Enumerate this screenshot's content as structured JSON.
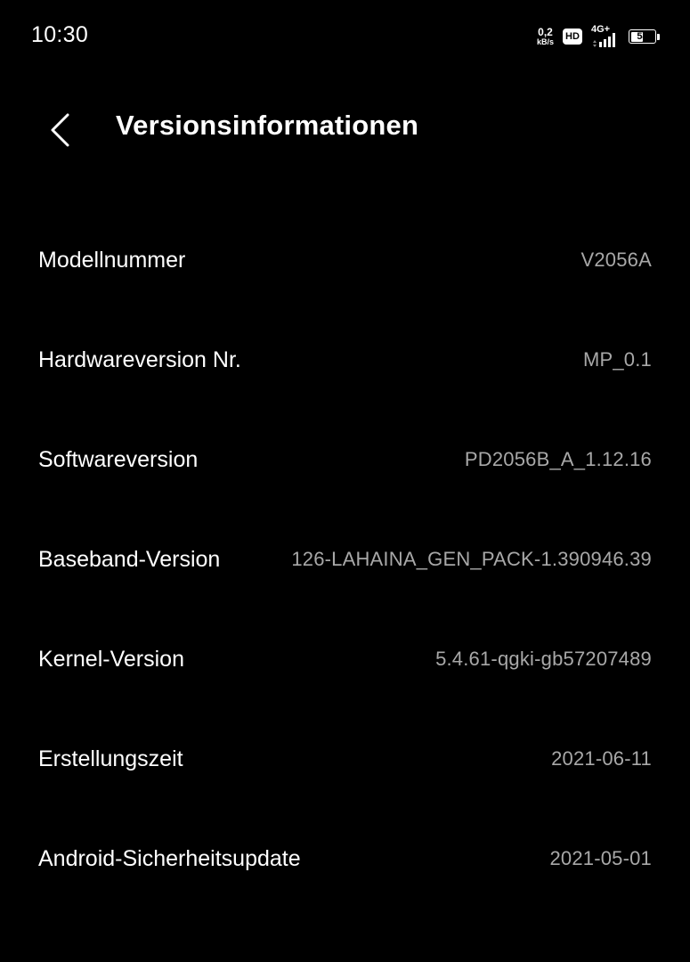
{
  "status_bar": {
    "time": "10:30",
    "net_speed_value": "0,2",
    "net_speed_unit": "kB/s",
    "hd_label": "HD",
    "network_type": "4G+",
    "battery_level": "54",
    "battery_fraction": 0.54,
    "icons": [
      "hd-volte-icon",
      "signal-4g-plus-icon",
      "battery-icon"
    ]
  },
  "header": {
    "back_icon": "chevron-left-icon",
    "title": "Versionsinformationen"
  },
  "info_rows": [
    {
      "label": "Modellnummer",
      "value": "V2056A"
    },
    {
      "label": "Hardwareversion Nr.",
      "value": "MP_0.1"
    },
    {
      "label": "Softwareversion",
      "value": "PD2056B_A_1.12.16"
    },
    {
      "label": "Baseband-Version",
      "value": "126-LAHAINA_GEN_PACK-1.390946.39"
    },
    {
      "label": "Kernel-Version",
      "value": "5.4.61-qgki-gb57207489"
    },
    {
      "label": "Erstellungszeit",
      "value": "2021-06-11"
    },
    {
      "label": "Android-Sicherheitsupdate",
      "value": "2021-05-01"
    }
  ],
  "colors": {
    "background": "#000000",
    "primary_text": "#ffffff",
    "secondary_text": "#a8a8a8"
  }
}
